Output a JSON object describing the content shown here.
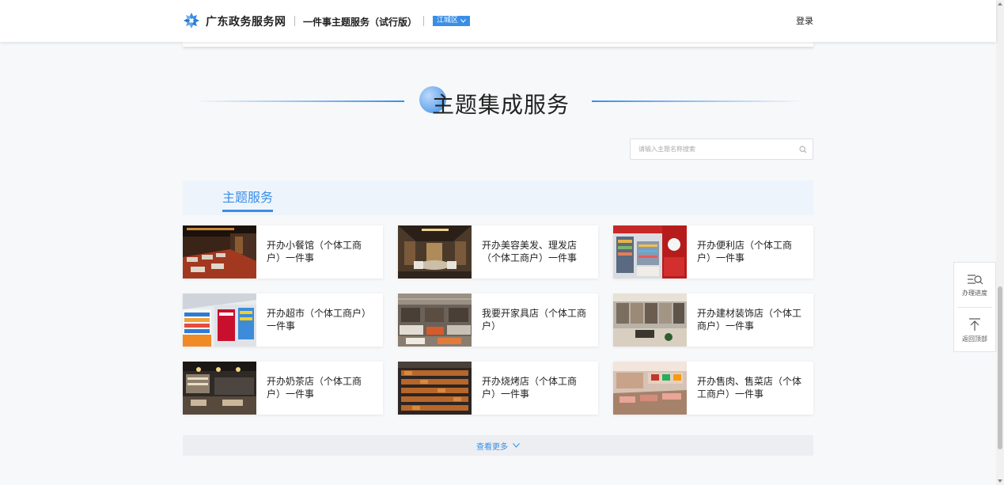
{
  "header": {
    "brand": "广东政务服务网",
    "subtitle": "一件事主题服务（试行版）",
    "region": "江城区",
    "login": "登录"
  },
  "section": {
    "title": "主题集成服务"
  },
  "search": {
    "placeholder": "请输入主题名称搜索",
    "icon": "search-icon"
  },
  "tabs": [
    {
      "label": "主题服务",
      "active": true
    }
  ],
  "cards": [
    {
      "label": "开办小餐馆（个体工商户）一件事",
      "image": "restaurant-photo"
    },
    {
      "label": "开办美容美发、理发店（个体工商户）一件事",
      "image": "salon-photo"
    },
    {
      "label": "开办便利店（个体工商户）一件事",
      "image": "convenience-store-photo"
    },
    {
      "label": "开办超市（个体工商户）一件事",
      "image": "supermarket-photo"
    },
    {
      "label": "我要开家具店（个体工商户）",
      "image": "furniture-store-photo"
    },
    {
      "label": "开办建材装饰店（个体工商户）一件事",
      "image": "building-materials-photo"
    },
    {
      "label": "开办奶茶店（个体工商户）一件事",
      "image": "tea-shop-photo"
    },
    {
      "label": "开办烧烤店（个体工商户）一件事",
      "image": "barbecue-photo"
    },
    {
      "label": "开办售肉、售菜店（个体工商户）一件事",
      "image": "meat-vegetable-store-photo"
    }
  ],
  "more": {
    "label": "查看更多",
    "icon": "chevron-down-icon"
  },
  "side_panel": {
    "progress_label": "办理进度",
    "progress_icon": "list-search-icon",
    "top_label": "返回顶部",
    "top_icon": "arrow-up-icon"
  },
  "colors": {
    "accent": "#3a8ee6",
    "background": "#f7f8fa",
    "tab_bar": "#eef4fb"
  }
}
